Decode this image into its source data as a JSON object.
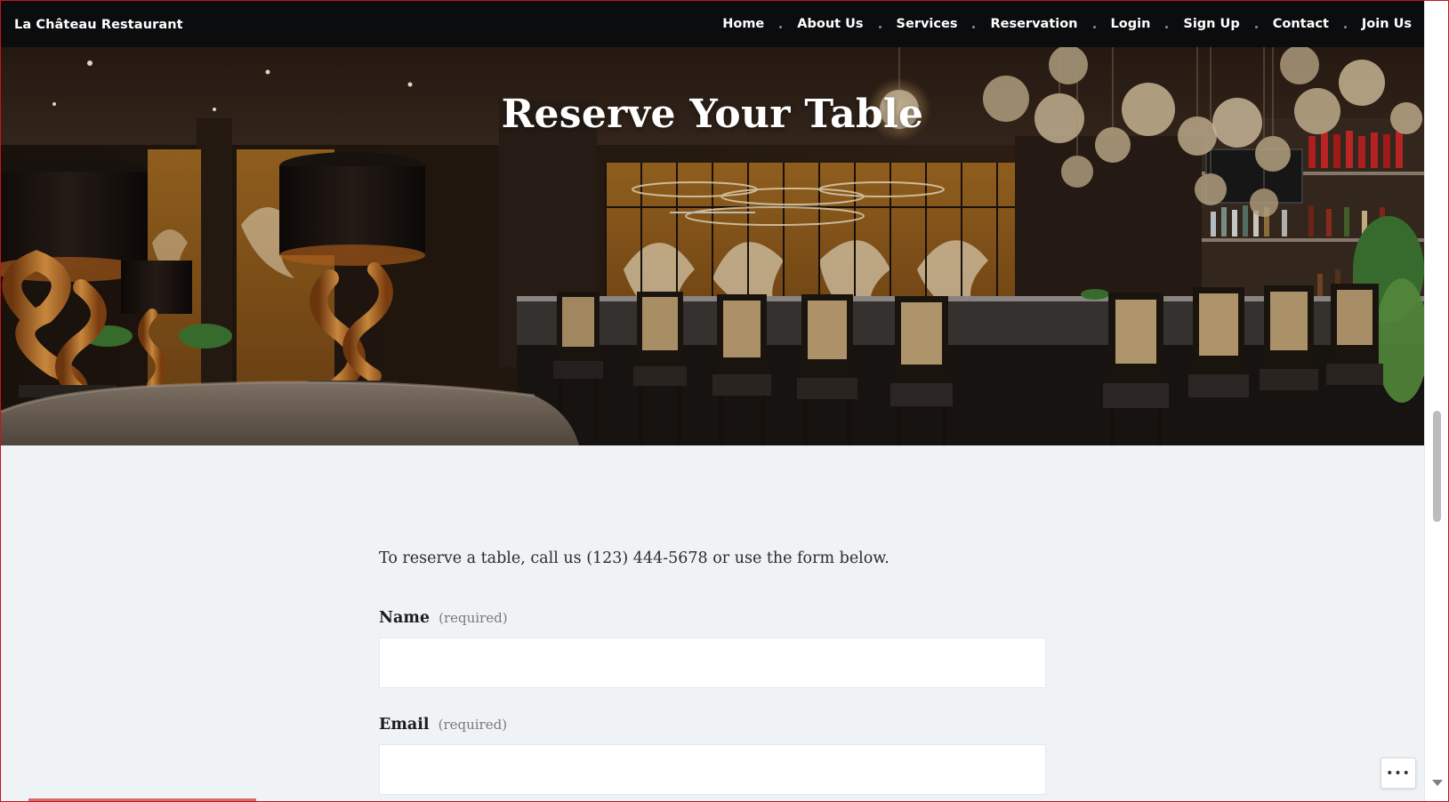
{
  "site": {
    "brand": "La Château Restaurant"
  },
  "nav": {
    "items": [
      {
        "label": "Home"
      },
      {
        "label": "About Us"
      },
      {
        "label": "Services"
      },
      {
        "label": "Reservation"
      },
      {
        "label": "Login"
      },
      {
        "label": "Sign Up"
      },
      {
        "label": "Contact"
      },
      {
        "label": "Join Us"
      }
    ]
  },
  "hero": {
    "title": "Reserve Your Table"
  },
  "content": {
    "intro": "To reserve a table, call us (123) 444-5678 or use the form below.",
    "form": {
      "name_label": "Name",
      "name_required": "(required)",
      "name_value": "",
      "email_label": "Email",
      "email_required": "(required)",
      "email_value": ""
    }
  },
  "ui": {
    "more_button_icon": "more-horizontal-icon",
    "more_button_glyph": "•••"
  },
  "colors": {
    "nav_bg": "#0b0c0e",
    "page_bg": "#eff3f6",
    "text_dark": "#1c1c1c",
    "text_muted": "#7a7a7a"
  }
}
